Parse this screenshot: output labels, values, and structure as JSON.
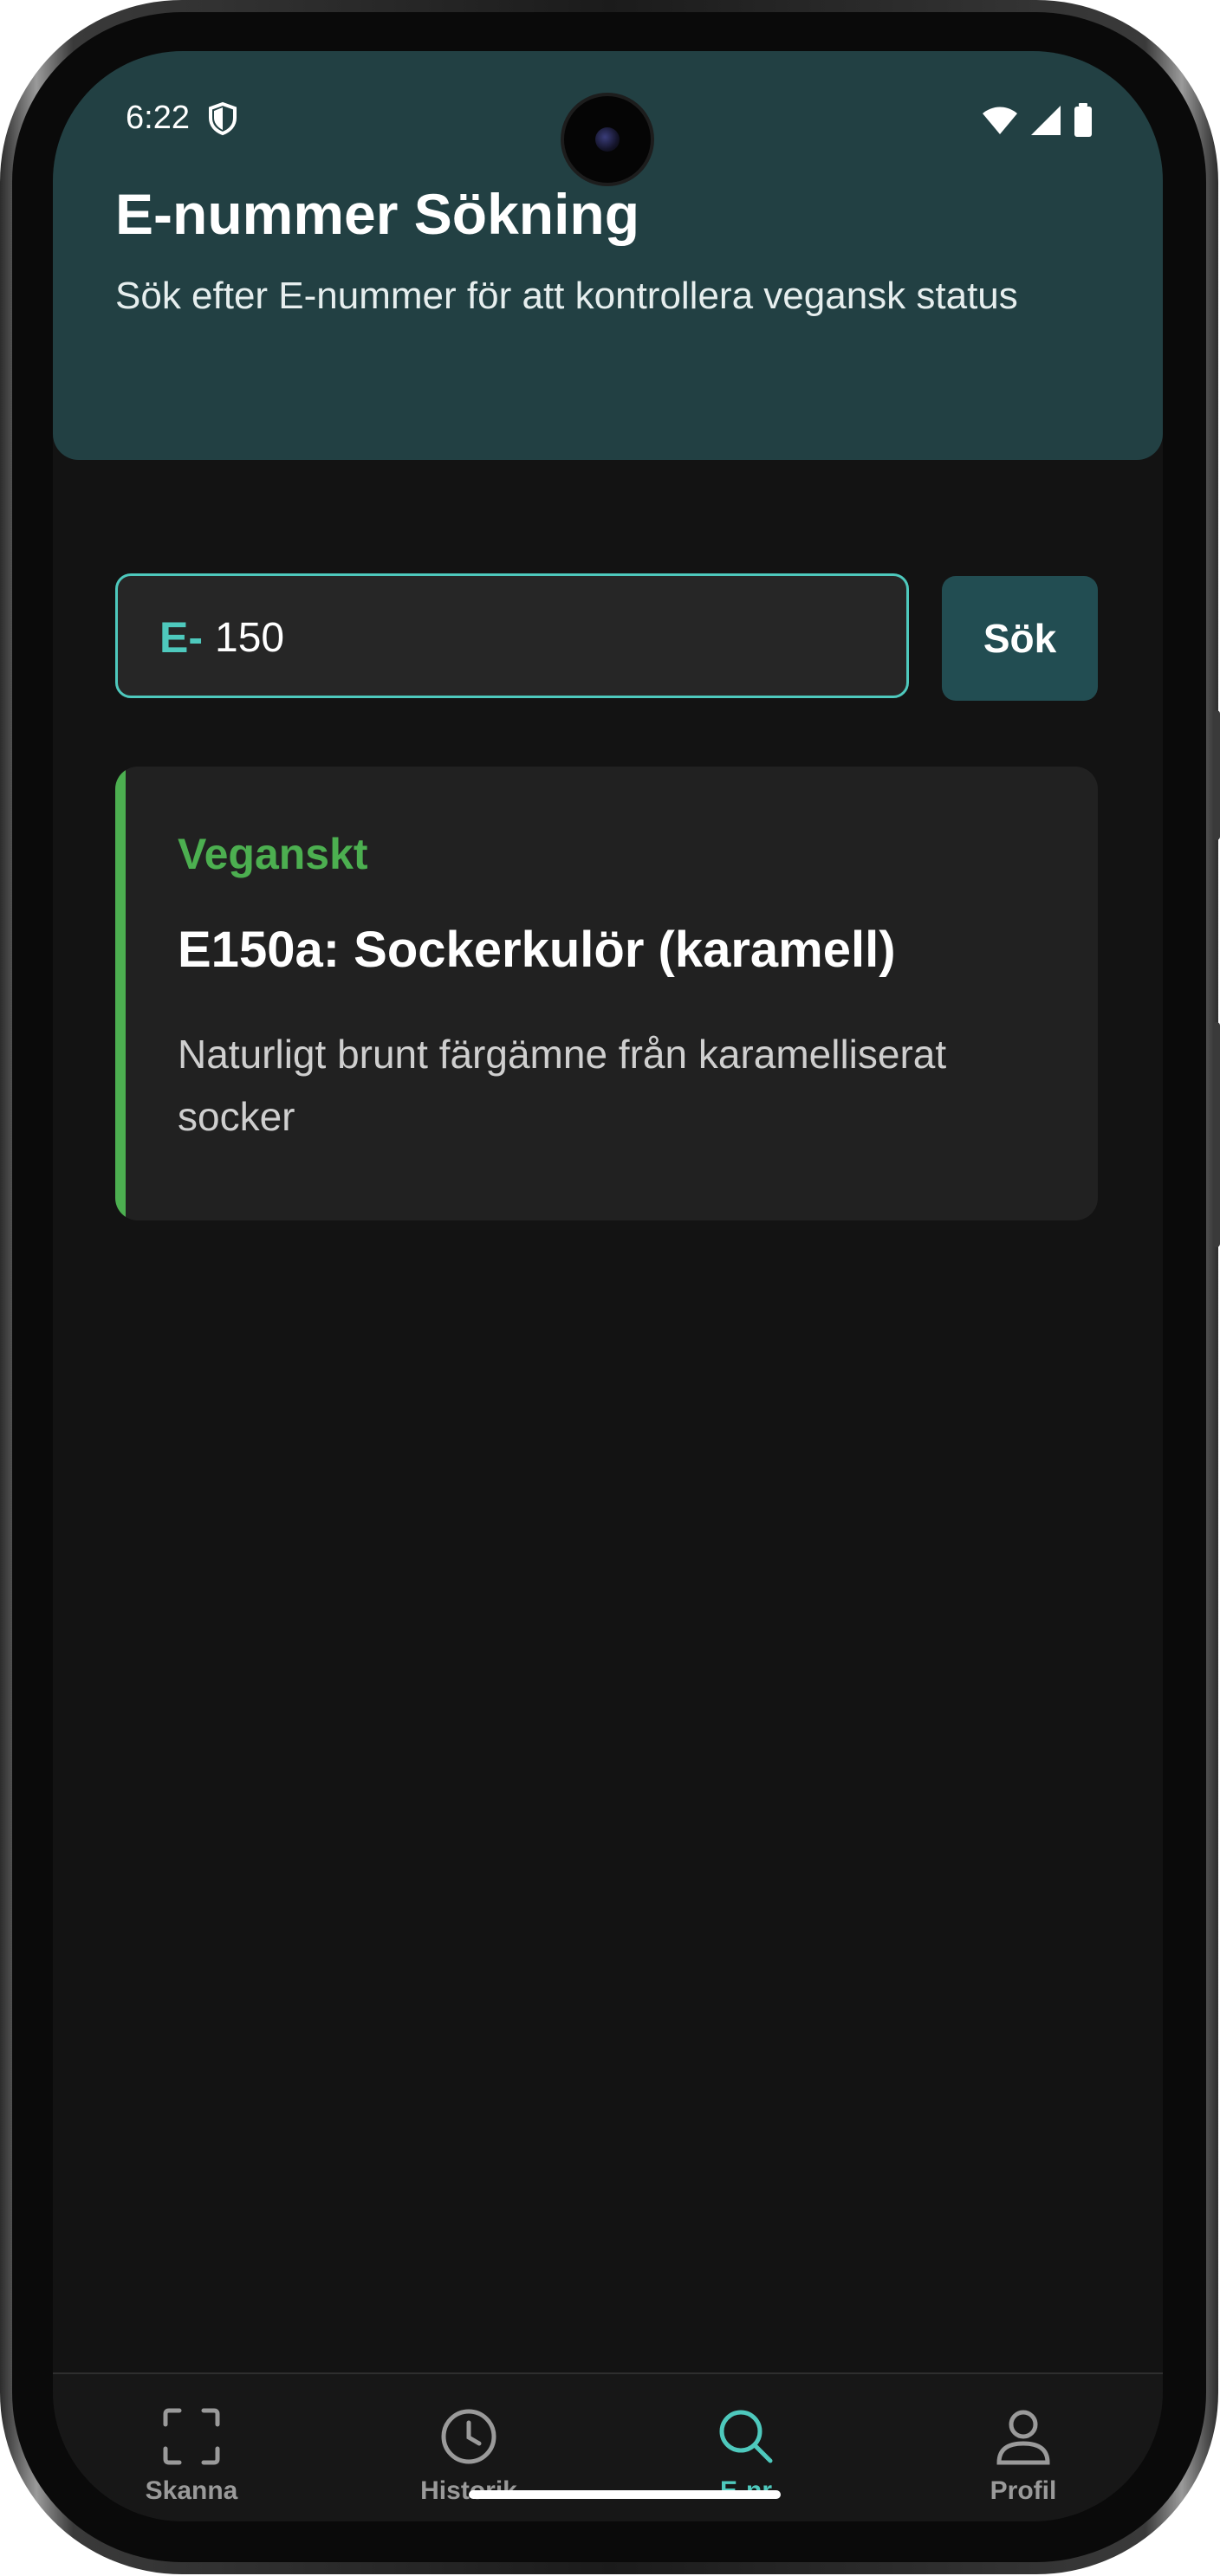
{
  "status_bar": {
    "time": "6:22"
  },
  "header": {
    "title": "E-nummer Sökning",
    "subtitle": "Sök efter E-nummer för att kontrollera vegansk status"
  },
  "search": {
    "prefix": "E-",
    "value": "150",
    "button_label": "Sök"
  },
  "result": {
    "status": "Veganskt",
    "title": "E150a: Sockerkulör (karamell)",
    "description": "Naturligt brunt färgämne från karamelliserat socker",
    "accent_color": "#4caf50"
  },
  "bottom_nav": {
    "items": [
      {
        "label": "Skanna",
        "icon": "scan-icon",
        "active": false
      },
      {
        "label": "Historik",
        "icon": "clock-icon",
        "active": false
      },
      {
        "label": "E-nr",
        "icon": "search-icon",
        "active": true
      },
      {
        "label": "Profil",
        "icon": "person-icon",
        "active": false
      }
    ]
  },
  "colors": {
    "header_bg": "#224043",
    "accent": "#4ec9bd",
    "vegan_green": "#4caf50",
    "background": "#131313"
  }
}
